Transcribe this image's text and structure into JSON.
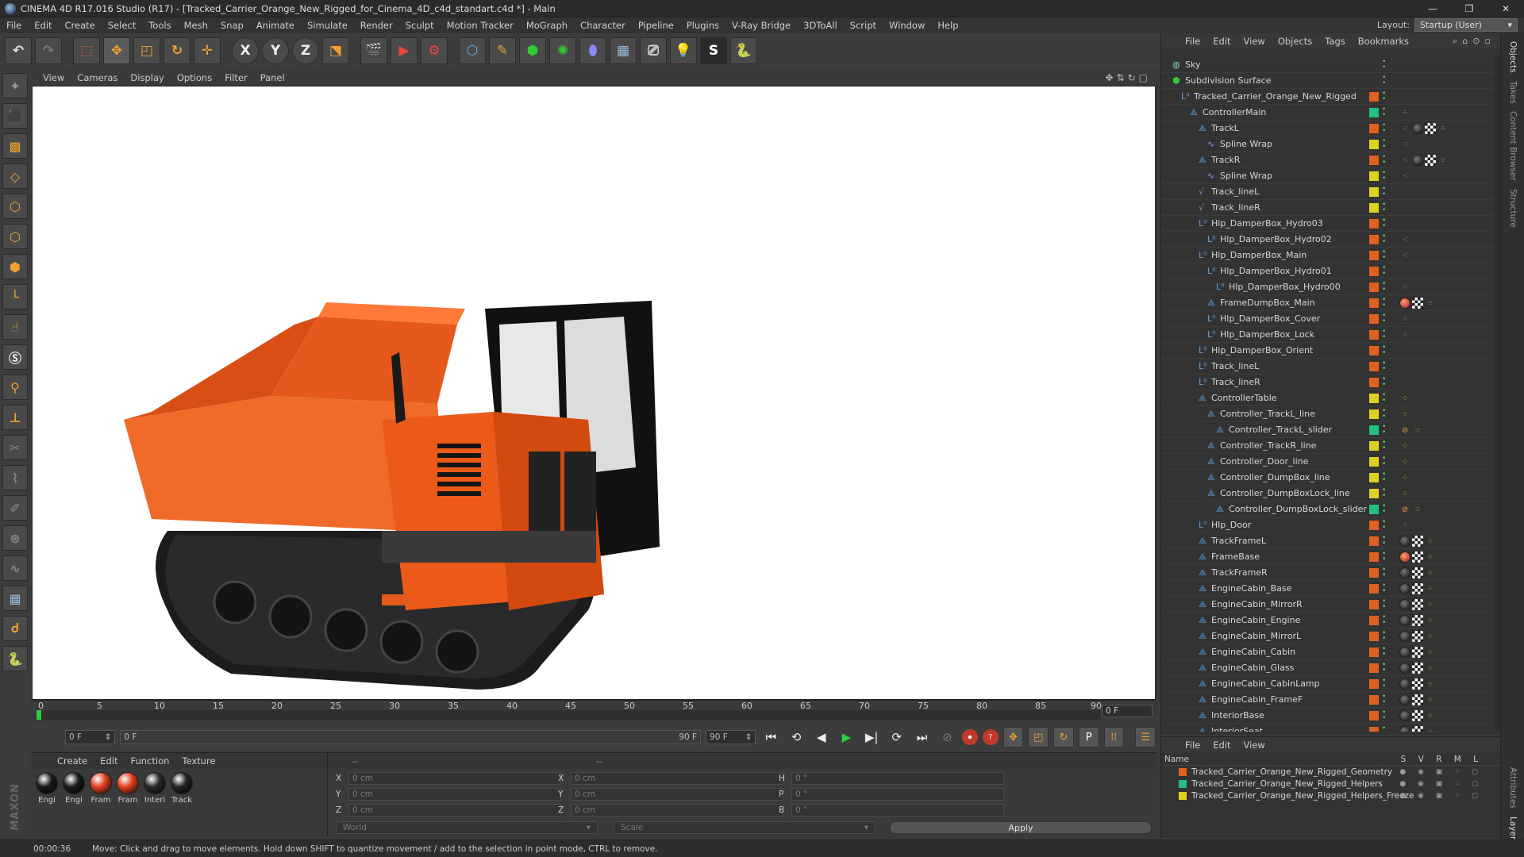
{
  "window": {
    "title": "CINEMA 4D R17.016 Studio (R17) - [Tracked_Carrier_Orange_New_Rigged_for_Cinema_4D_c4d_standart.c4d *] - Main",
    "controls": [
      "—",
      "❐",
      "✕"
    ]
  },
  "menubar": {
    "items": [
      "File",
      "Edit",
      "Create",
      "Select",
      "Tools",
      "Mesh",
      "Snap",
      "Animate",
      "Simulate",
      "Render",
      "Sculpt",
      "Motion Tracker",
      "MoGraph",
      "Character",
      "Pipeline",
      "Plugins",
      "V-Ray Bridge",
      "3DToAll",
      "Script",
      "Window",
      "Help"
    ],
    "layout_label": "Layout:",
    "layout_value": "Startup (User)"
  },
  "toolbar": {
    "icons": [
      "undo-icon",
      "redo-icon",
      "select-icon",
      "move-icon",
      "scale-icon",
      "rotate-icon",
      "live-select-icon",
      "x-axis-icon",
      "y-axis-icon",
      "z-axis-icon",
      "coord-system-icon",
      "render-view-icon",
      "render-picture-icon",
      "render-settings-icon",
      "cube-icon",
      "pen-icon",
      "subdivision-icon",
      "array-icon",
      "deformer-icon",
      "floor-icon",
      "camera-icon",
      "light-icon",
      "python-s-icon",
      "python-icon"
    ],
    "axis_labels": [
      "X",
      "Y",
      "Z"
    ]
  },
  "viewport": {
    "menu": [
      "View",
      "Cameras",
      "Display",
      "Options",
      "Filter",
      "Panel"
    ]
  },
  "timeline": {
    "ticks": [
      "0",
      "5",
      "10",
      "15",
      "20",
      "25",
      "30",
      "35",
      "40",
      "45",
      "50",
      "55",
      "60",
      "65",
      "70",
      "75",
      "80",
      "85",
      "90"
    ],
    "current_frame": "0 F"
  },
  "transport": {
    "start_field": "0 F",
    "range_start": "0 F",
    "range_end": "90 F",
    "end_field": "90 F"
  },
  "material_manager": {
    "menu": [
      "Create",
      "Edit",
      "Function",
      "Texture"
    ],
    "materials": [
      {
        "label": "Engi",
        "color": "#1a1a1a"
      },
      {
        "label": "Engi",
        "color": "#1a1a1a"
      },
      {
        "label": "Fram",
        "color": "#e04020"
      },
      {
        "label": "Fram",
        "color": "#e04020"
      },
      {
        "label": "Interi",
        "color": "#2a2a2a"
      },
      {
        "label": "Track",
        "color": "#222222"
      }
    ]
  },
  "coordinates": {
    "header": [
      "--",
      "--",
      "--"
    ],
    "rows": [
      {
        "a": "X",
        "av": "0 cm",
        "b": "X",
        "bv": "0 cm",
        "c": "H",
        "cv": "0 °"
      },
      {
        "a": "Y",
        "av": "0 cm",
        "b": "Y",
        "bv": "0 cm",
        "c": "P",
        "cv": "0 °"
      },
      {
        "a": "Z",
        "av": "0 cm",
        "b": "Z",
        "bv": "0 cm",
        "c": "B",
        "cv": "0 °"
      }
    ],
    "world": "World",
    "scale": "Scale",
    "apply": "Apply"
  },
  "status": {
    "time": "00:00:36",
    "message": "Move: Click and drag to move elements. Hold down SHIFT to quantize movement / add to the selection in point mode, CTRL to remove."
  },
  "object_manager": {
    "menu": [
      "File",
      "Edit",
      "View",
      "Objects",
      "Tags",
      "Bookmarks"
    ],
    "objects": [
      {
        "name": "Sky",
        "depth": 0,
        "icon": "sky-icon",
        "layer": "",
        "tags": []
      },
      {
        "name": "Subdivision Surface",
        "depth": 0,
        "icon": "subdivision-icon",
        "layer": "",
        "tags": []
      },
      {
        "name": "Tracked_Carrier_Orange_New_Rigged",
        "depth": 1,
        "icon": "null-icon",
        "layer": "#e06020",
        "tags": []
      },
      {
        "name": "ControllerMain",
        "depth": 2,
        "icon": "joint-icon",
        "layer": "#20c080",
        "tags": [
          "dot"
        ]
      },
      {
        "name": "TrackL",
        "depth": 3,
        "icon": "joint-icon",
        "layer": "#e06020",
        "tags": [
          "sw",
          "mat",
          "chk",
          "dot"
        ]
      },
      {
        "name": "Spline Wrap",
        "depth": 4,
        "icon": "spline-wrap-icon",
        "layer": "#e0d020",
        "tags": [
          "sw"
        ]
      },
      {
        "name": "TrackR",
        "depth": 3,
        "icon": "joint-icon",
        "layer": "#e06020",
        "tags": [
          "sw",
          "mat",
          "chk",
          "dot"
        ]
      },
      {
        "name": "Spline Wrap",
        "depth": 4,
        "icon": "spline-wrap-icon",
        "layer": "#e0d020",
        "tags": [
          "sw"
        ]
      },
      {
        "name": "Track_lineL",
        "depth": 3,
        "icon": "spline-icon",
        "layer": "#e0d020",
        "tags": []
      },
      {
        "name": "Track_lineR",
        "depth": 3,
        "icon": "spline-icon",
        "layer": "#e0d020",
        "tags": []
      },
      {
        "name": "Hlp_DamperBox_Hydro03",
        "depth": 3,
        "icon": "null-icon",
        "layer": "#e06020",
        "tags": []
      },
      {
        "name": "Hlp_DamperBox_Hydro02",
        "depth": 4,
        "icon": "null-icon",
        "layer": "#e06020",
        "tags": [
          "sw"
        ]
      },
      {
        "name": "Hlp_DamperBox_Main",
        "depth": 3,
        "icon": "null-icon",
        "layer": "#e06020",
        "tags": [
          "sw"
        ]
      },
      {
        "name": "Hlp_DamperBox_Hydro01",
        "depth": 4,
        "icon": "null-icon",
        "layer": "#e06020",
        "tags": []
      },
      {
        "name": "Hlp_DamperBox_Hydro00",
        "depth": 5,
        "icon": "null-icon",
        "layer": "#e06020",
        "tags": [
          "sw"
        ]
      },
      {
        "name": "FrameDumpBox_Main",
        "depth": 4,
        "icon": "joint-icon",
        "layer": "#e06020",
        "tags": [
          "mato",
          "chk",
          "dot"
        ]
      },
      {
        "name": "Hlp_DamperBox_Cover",
        "depth": 4,
        "icon": "null-icon",
        "layer": "#e06020",
        "tags": [
          "sw"
        ]
      },
      {
        "name": "Hlp_DamperBox_Lock",
        "depth": 4,
        "icon": "null-icon",
        "layer": "#e06020",
        "tags": [
          "sw"
        ]
      },
      {
        "name": "Hlp_DamperBox_Orient",
        "depth": 3,
        "icon": "null-icon",
        "layer": "#e06020",
        "tags": []
      },
      {
        "name": "Track_lineL",
        "depth": 3,
        "icon": "null-icon",
        "layer": "#e06020",
        "tags": []
      },
      {
        "name": "Track_lineR",
        "depth": 3,
        "icon": "null-icon",
        "layer": "#e06020",
        "tags": []
      },
      {
        "name": "ControllerTable",
        "depth": 3,
        "icon": "joint-icon",
        "layer": "#e0d020",
        "tags": [
          "dot"
        ]
      },
      {
        "name": "Controller_TrackL_line",
        "depth": 4,
        "icon": "joint-icon",
        "layer": "#e0d020",
        "tags": [
          "dot"
        ]
      },
      {
        "name": "Controller_TrackL_slider",
        "depth": 5,
        "icon": "joint-icon",
        "layer": "#20c080",
        "tags": [
          "no",
          "dot"
        ]
      },
      {
        "name": "Controller_TrackR_line",
        "depth": 4,
        "icon": "joint-icon",
        "layer": "#e0d020",
        "tags": [
          "dot"
        ]
      },
      {
        "name": "Controller_Door_line",
        "depth": 4,
        "icon": "joint-icon",
        "layer": "#e0d020",
        "tags": [
          "dot"
        ]
      },
      {
        "name": "Controller_DumpBox_line",
        "depth": 4,
        "icon": "joint-icon",
        "layer": "#e0d020",
        "tags": [
          "dot"
        ]
      },
      {
        "name": "Controller_DumpBoxLock_line",
        "depth": 4,
        "icon": "joint-icon",
        "layer": "#e0d020",
        "tags": [
          "dot"
        ]
      },
      {
        "name": "Controller_DumpBoxLock_slider",
        "depth": 5,
        "icon": "joint-icon",
        "layer": "#20c080",
        "tags": [
          "no",
          "dot"
        ]
      },
      {
        "name": "Hlp_Door",
        "depth": 3,
        "icon": "null-icon",
        "layer": "#e06020",
        "tags": [
          "sw"
        ]
      },
      {
        "name": "TrackFrameL",
        "depth": 3,
        "icon": "joint-icon",
        "layer": "#e06020",
        "tags": [
          "mat",
          "chk",
          "dot"
        ]
      },
      {
        "name": "FrameBase",
        "depth": 3,
        "icon": "joint-icon",
        "layer": "#e06020",
        "tags": [
          "mato",
          "chk",
          "dot"
        ]
      },
      {
        "name": "TrackFrameR",
        "depth": 3,
        "icon": "joint-icon",
        "layer": "#e06020",
        "tags": [
          "mat",
          "chk",
          "dot"
        ]
      },
      {
        "name": "EngineCabin_Base",
        "depth": 3,
        "icon": "joint-icon",
        "layer": "#e06020",
        "tags": [
          "mat",
          "chk",
          "dot"
        ]
      },
      {
        "name": "EngineCabin_MirrorR",
        "depth": 3,
        "icon": "joint-icon",
        "layer": "#e06020",
        "tags": [
          "mat",
          "chk",
          "dot"
        ]
      },
      {
        "name": "EngineCabin_Engine",
        "depth": 3,
        "icon": "joint-icon",
        "layer": "#e06020",
        "tags": [
          "mat",
          "chk",
          "dot"
        ]
      },
      {
        "name": "EngineCabin_MirrorL",
        "depth": 3,
        "icon": "joint-icon",
        "layer": "#e06020",
        "tags": [
          "mat",
          "chk",
          "dot"
        ]
      },
      {
        "name": "EngineCabin_Cabin",
        "depth": 3,
        "icon": "joint-icon",
        "layer": "#e06020",
        "tags": [
          "mat",
          "chk",
          "dot"
        ]
      },
      {
        "name": "EngineCabin_Glass",
        "depth": 3,
        "icon": "joint-icon",
        "layer": "#e06020",
        "tags": [
          "mat",
          "chk",
          "dot"
        ]
      },
      {
        "name": "EngineCabin_CabinLamp",
        "depth": 3,
        "icon": "joint-icon",
        "layer": "#e06020",
        "tags": [
          "mat",
          "chk",
          "dot"
        ]
      },
      {
        "name": "EngineCabin_FrameF",
        "depth": 3,
        "icon": "joint-icon",
        "layer": "#e06020",
        "tags": [
          "mat",
          "chk",
          "dot"
        ]
      },
      {
        "name": "InteriorBase",
        "depth": 3,
        "icon": "joint-icon",
        "layer": "#e06020",
        "tags": [
          "mat",
          "chk",
          "dot"
        ]
      },
      {
        "name": "InteriorSeat",
        "depth": 3,
        "icon": "joint-icon",
        "layer": "#e06020",
        "tags": [
          "mat",
          "chk",
          "dot"
        ]
      }
    ]
  },
  "layer_manager": {
    "menu": [
      "File",
      "Edit",
      "View"
    ],
    "header_name": "Name",
    "header_cols": "S V R M L",
    "layers": [
      {
        "name": "Tracked_Carrier_Orange_New_Rigged_Geometry",
        "color": "#e06020"
      },
      {
        "name": "Tracked_Carrier_Orange_New_Rigged_Helpers",
        "color": "#20c080"
      },
      {
        "name": "Tracked_Carrier_Orange_New_Rigged_Helpers_Freeze",
        "color": "#e0d020"
      }
    ]
  },
  "side_tabs": [
    "Objects",
    "Takes",
    "Content Browser",
    "Structure"
  ],
  "side_tabs_bottom": [
    "Attributes",
    "Layers"
  ]
}
